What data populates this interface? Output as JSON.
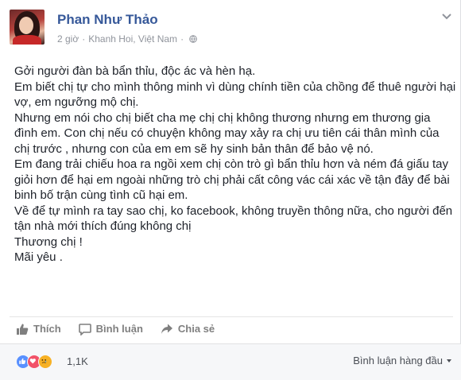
{
  "post": {
    "author": "Phan Như Thảo",
    "time": "2 giờ",
    "separator": "·",
    "location": "Khanh Hoi, Việt Nam",
    "separator2": "·",
    "privacy_icon": "globe-icon",
    "menu_icon": "chevron-down-icon",
    "paragraphs": [
      "Gởi người đàn bà bẩn thỉu, độc ác và hèn hạ.",
      "Em biết chị tự cho mình thông minh vì dùng chính tiền của chồng để thuê người hại vợ, em ngưỡng mộ chị.",
      "Nhưng em nói cho chị biết cha mẹ chị chị không thương nhưng em thương gia đình em. Con chị nếu có chuyện không may xảy ra chị ưu tiên cái thân mình của chị trước , nhưng con của em em sẽ hy sinh bản thân để bảo vệ nó.",
      "Em đang trải chiếu hoa ra ngồi xem chị còn trò gì bẩn thỉu hơn và ném đá giấu tay giỏi hơn để hại em ngoài những trò chị phải cất công vác cái xác về tận đây để bài binh bố trận cùng tình cũ hại em.",
      "Về để tự mình ra tay sao chị, ko facebook, không truyền thông nữa, cho người đến tận nhà mới thích đúng không chị",
      "Thương chị !",
      "Mãi yêu ."
    ]
  },
  "actions": {
    "like": "Thích",
    "comment": "Bình luận",
    "share": "Chia sẻ"
  },
  "footer": {
    "reaction_count": "1,1K",
    "reactions": [
      "like",
      "love",
      "sad"
    ],
    "sort_label": "Bình luận hàng đầu",
    "colors": {
      "like": "#5890ff",
      "love": "#f25268",
      "sad": "#f7b125"
    }
  }
}
